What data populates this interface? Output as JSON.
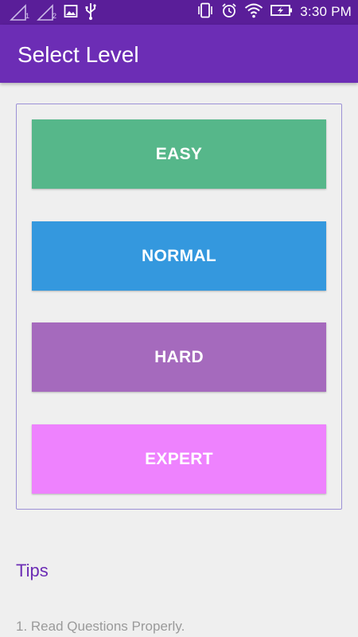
{
  "status_bar": {
    "sim1_label": "1",
    "sim2_label": "2",
    "time": "3:30 PM",
    "icons": [
      "signal-sim1-icon",
      "signal-sim2-icon",
      "image-notification-icon",
      "usb-icon",
      "vibrate-icon",
      "alarm-icon",
      "wifi-icon",
      "battery-charging-icon"
    ]
  },
  "app_bar": {
    "title": "Select Level"
  },
  "levels": [
    {
      "label": "EASY",
      "color": "#56b78a"
    },
    {
      "label": "NORMAL",
      "color": "#3498de"
    },
    {
      "label": "HARD",
      "color": "#a56abd"
    },
    {
      "label": "EXPERT",
      "color": "#ee82fe"
    }
  ],
  "tips": {
    "title": "Tips",
    "items": [
      "1. Read Questions Properly."
    ]
  },
  "colors": {
    "status_bar": "#5a1e99",
    "app_bar": "#6c2db5",
    "background": "#efefef",
    "card_border": "#9c91d6",
    "tips_title": "#6c2db5",
    "tip_text": "#9a9a9a"
  }
}
